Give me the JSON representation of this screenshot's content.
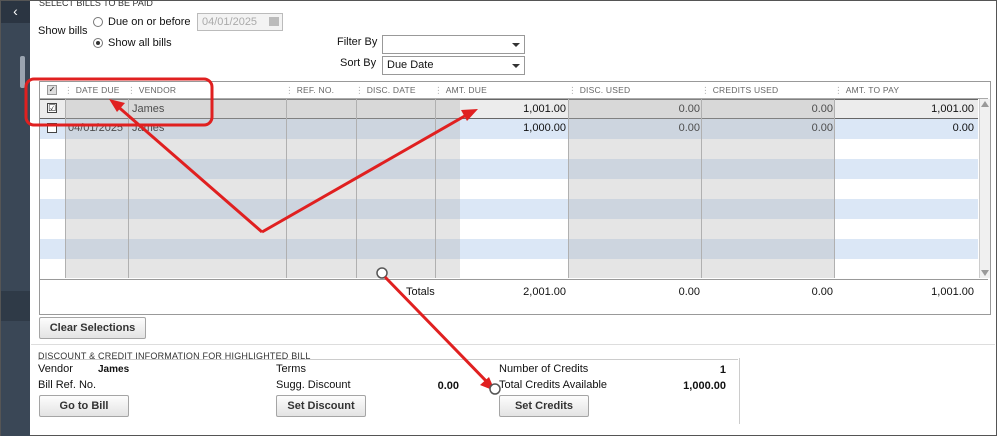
{
  "header": {
    "section_cut": "SELECT BILLS TO BE PAID"
  },
  "show_bills": {
    "label": "Show bills",
    "option_due": "Due on or before",
    "option_all": "Show all bills",
    "date_value": "04/01/2025"
  },
  "filter": {
    "label": "Filter By",
    "value": ""
  },
  "sort": {
    "label": "Sort By",
    "value": "Due Date"
  },
  "grid": {
    "columns": [
      "DATE DUE",
      "VENDOR",
      "REF. NO.",
      "DISC. DATE",
      "AMT. DUE",
      "DISC. USED",
      "CREDITS USED",
      "AMT. TO PAY"
    ],
    "rows": [
      {
        "checked": "☑",
        "date_due": "",
        "vendor": "James",
        "ref": "",
        "disc_date": "",
        "amt_due": "1,001.00",
        "disc_used": "0.00",
        "credits_used": "0.00",
        "amt_to_pay": "1,001.00"
      },
      {
        "checked": "",
        "date_due": "04/01/2025",
        "vendor": "James",
        "ref": "",
        "disc_date": "",
        "amt_due": "1,000.00",
        "disc_used": "0.00",
        "credits_used": "0.00",
        "amt_to_pay": "0.00"
      }
    ],
    "totals": {
      "label": "Totals",
      "amt_due": "2,001.00",
      "disc_used": "0.00",
      "credits_used": "0.00",
      "amt_to_pay": "1,001.00"
    }
  },
  "buttons": {
    "clear_selections": "Clear Selections",
    "go_to_bill": "Go to Bill",
    "set_discount": "Set Discount",
    "set_credits": "Set Credits"
  },
  "discount_info": {
    "title": "DISCOUNT & CREDIT INFORMATION FOR HIGHLIGHTED BILL",
    "vendor_label": "Vendor",
    "vendor_value": "James",
    "bill_ref_label": "Bill Ref. No.",
    "terms_label": "Terms",
    "sugg_discount_label": "Sugg. Discount",
    "sugg_discount_value": "0.00",
    "num_credits_label": "Number of Credits",
    "num_credits_value": "1",
    "total_credits_label": "Total Credits Available",
    "total_credits_value": "1,000.00"
  },
  "colors": {
    "annotation": "#e02020",
    "row_blue": "#dbe7f6",
    "panel": "#3a4756"
  }
}
